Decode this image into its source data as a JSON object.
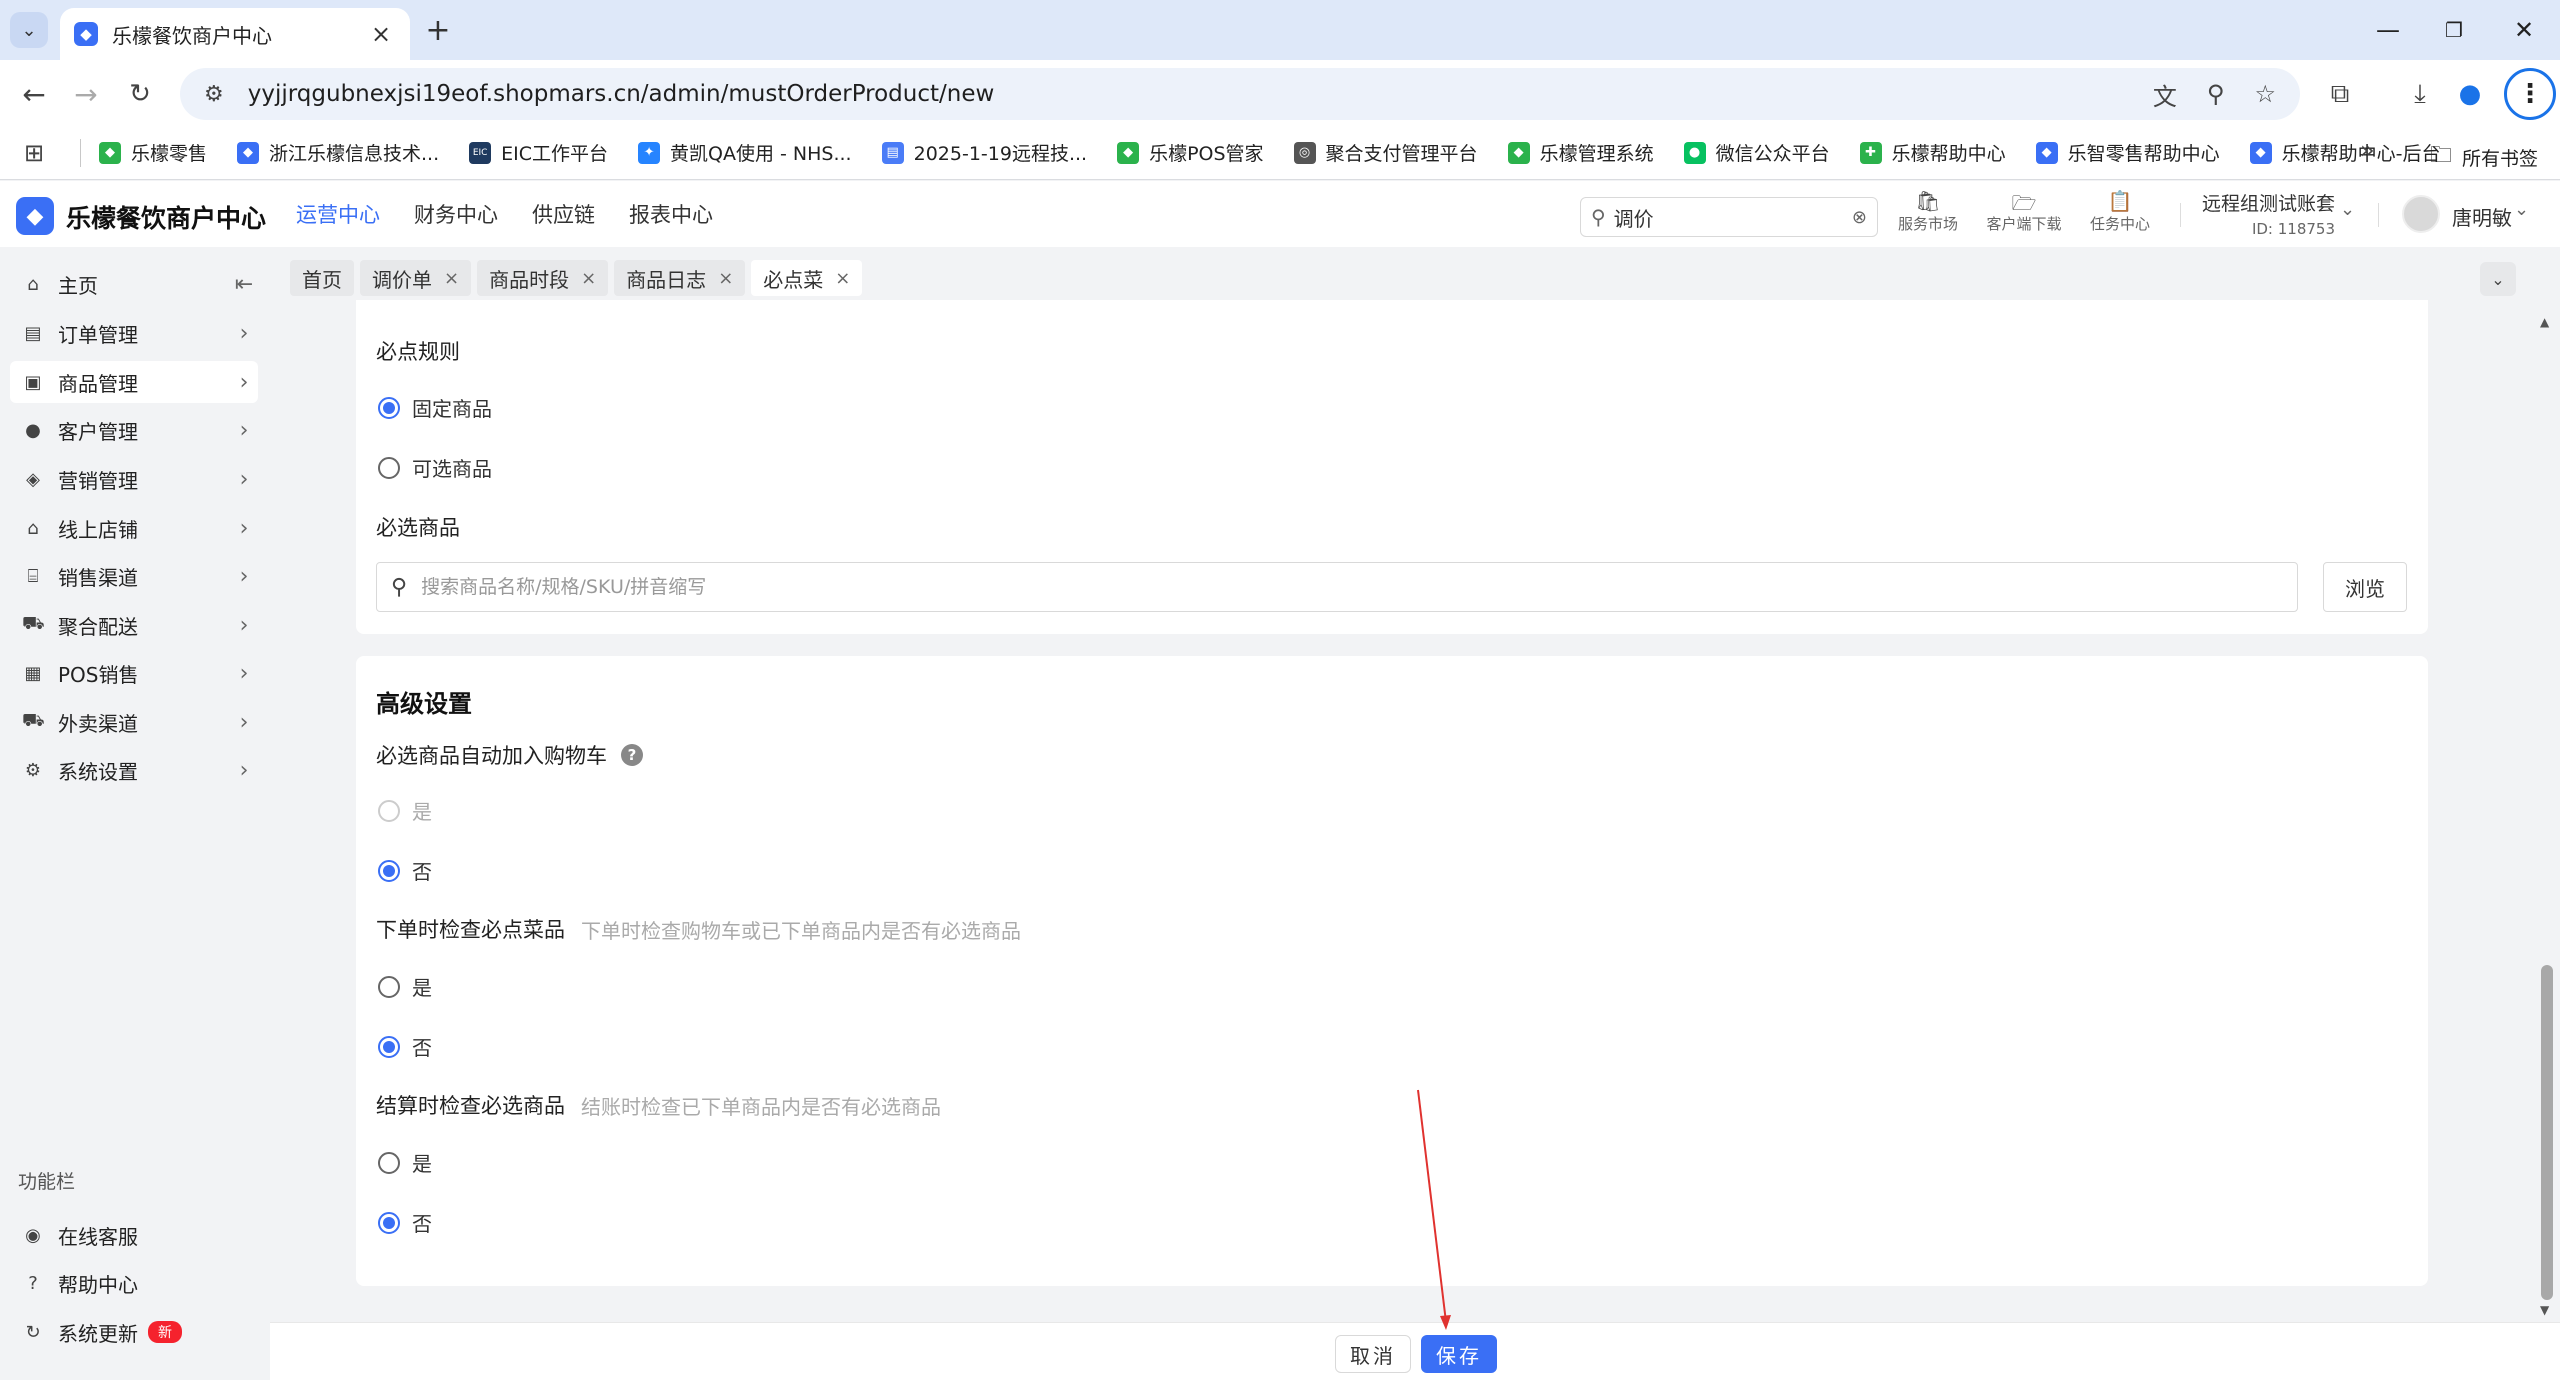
{
  "browser": {
    "tab_title": "乐檬餐饮商户中心",
    "url": "yyjjrqgubnexjsi19eof.shopmars.cn/admin/mustOrderProduct/new",
    "bookmarks": [
      {
        "label": "乐檬零售",
        "icon": "lemon-icon",
        "color": "#2bb24c"
      },
      {
        "label": "浙江乐檬信息技术...",
        "icon": "lemon-blue-icon",
        "color": "#3a6ff5"
      },
      {
        "label": "EIC工作平台",
        "icon": "eic-icon",
        "color": "#1f3a5f"
      },
      {
        "label": "黄凯QA使用 - NHS...",
        "icon": "jira-icon",
        "color": "#2684ff"
      },
      {
        "label": "2025-1-19远程技...",
        "icon": "doc-icon",
        "color": "#4a7cf7"
      },
      {
        "label": "乐檬POS管家",
        "icon": "lemon-icon",
        "color": "#2bb24c"
      },
      {
        "label": "聚合支付管理平台",
        "icon": "globe-icon",
        "color": "#555555"
      },
      {
        "label": "乐檬管理系统",
        "icon": "lemon-icon",
        "color": "#2bb24c"
      },
      {
        "label": "微信公众平台",
        "icon": "wechat-icon",
        "color": "#07c160"
      },
      {
        "label": "乐檬帮助中心",
        "icon": "help-center-icon",
        "color": "#2bb24c"
      },
      {
        "label": "乐智零售帮助中心",
        "icon": "lemon-blue-icon",
        "color": "#3a6ff5"
      },
      {
        "label": "乐檬帮助中心-后台",
        "icon": "lemon-blue-icon",
        "color": "#3a6ff5"
      }
    ],
    "all_bookmarks": "所有书签"
  },
  "app": {
    "name": "乐檬餐饮商户中心",
    "nav": [
      "运营中心",
      "财务中心",
      "供应链",
      "报表中心"
    ],
    "search_value": "调价",
    "tools": [
      "服务市场",
      "客户端下载",
      "任务中心"
    ],
    "account_name": "远程组测试账套",
    "account_id": "ID: 118753",
    "user_name": "唐明敏"
  },
  "sidebar": {
    "items": [
      {
        "label": "主页",
        "icon": "home-icon"
      },
      {
        "label": "订单管理",
        "icon": "order-icon"
      },
      {
        "label": "商品管理",
        "icon": "goods-icon"
      },
      {
        "label": "客户管理",
        "icon": "customer-icon"
      },
      {
        "label": "营销管理",
        "icon": "tag-icon"
      },
      {
        "label": "线上店铺",
        "icon": "store-icon"
      },
      {
        "label": "销售渠道",
        "icon": "bank-icon"
      },
      {
        "label": "聚合配送",
        "icon": "delivery-icon"
      },
      {
        "label": "POS销售",
        "icon": "pos-icon"
      },
      {
        "label": "外卖渠道",
        "icon": "takeout-icon"
      },
      {
        "label": "系统设置",
        "icon": "settings-icon"
      }
    ],
    "function_section": "功能栏",
    "functions": [
      {
        "label": "在线客服",
        "icon": "headset-icon"
      },
      {
        "label": "帮助中心",
        "icon": "question-icon"
      },
      {
        "label": "系统更新",
        "icon": "refresh-icon",
        "badge": "新"
      }
    ]
  },
  "page_tabs": [
    "首页",
    "调价单",
    "商品时段",
    "商品日志",
    "必点菜"
  ],
  "form": {
    "rule_label": "必点规则",
    "rule_options": [
      "固定商品",
      "可选商品"
    ],
    "products_label": "必选商品",
    "search_placeholder": "搜索商品名称/规格/SKU/拼音缩写",
    "browse": "浏览",
    "advanced_title": "高级设置",
    "auto_add_label": "必选商品自动加入购物车",
    "order_check_label": "下单时检查必点菜品",
    "order_check_hint": "下单时检查购物车或已下单商品内是否有必选商品",
    "settle_check_label": "结算时检查必选商品",
    "settle_check_hint": "结账时检查已下单商品内是否有必选商品",
    "yes": "是",
    "no": "否"
  },
  "footer": {
    "cancel": "取消",
    "save": "保存"
  },
  "colors": {
    "primary": "#3a6ff5",
    "annotation_arrow": "#e0322f"
  }
}
